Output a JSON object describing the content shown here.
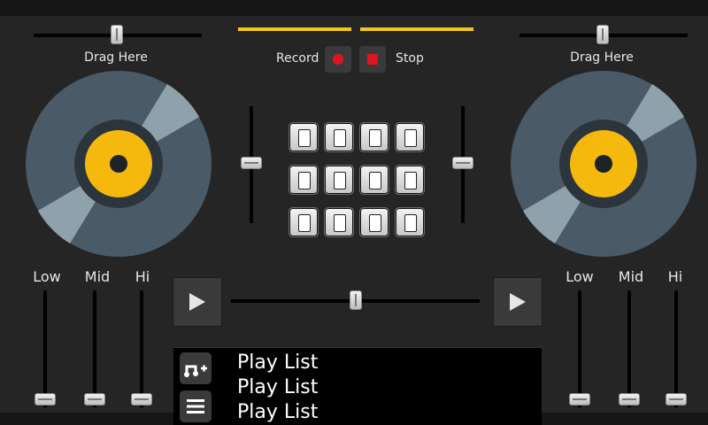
{
  "decks": {
    "left": {
      "drag_label": "Drag Here",
      "pitch_level": 0.49
    },
    "right": {
      "drag_label": "Drag Here",
      "pitch_level": 0.49
    }
  },
  "transport": {
    "record_label": "Record",
    "stop_label": "Stop",
    "record_icon": "record-dot-icon",
    "stop_icon": "stop-square-icon"
  },
  "pads": {
    "rows": 3,
    "cols": 4,
    "count": 12
  },
  "volume": {
    "left_level": 0.5,
    "right_level": 0.5
  },
  "eq": {
    "left": {
      "low_label": "Low",
      "mid_label": "Mid",
      "hi_label": "Hi"
    },
    "right": {
      "low_label": "Low",
      "mid_label": "Mid",
      "hi_label": "Hi"
    }
  },
  "crossfader": {
    "level": 0.5
  },
  "playlist": {
    "items": [
      "Play List",
      "Play List",
      "Play List"
    ],
    "add_icon": "music-add-icon",
    "menu_icon": "hamburger-menu-icon"
  },
  "colors": {
    "accent": "#f5c518",
    "record_red": "#e0141e",
    "platter": "#4a5a66",
    "platter_light": "#8fa1ab",
    "label_ring": "#2c353c"
  }
}
